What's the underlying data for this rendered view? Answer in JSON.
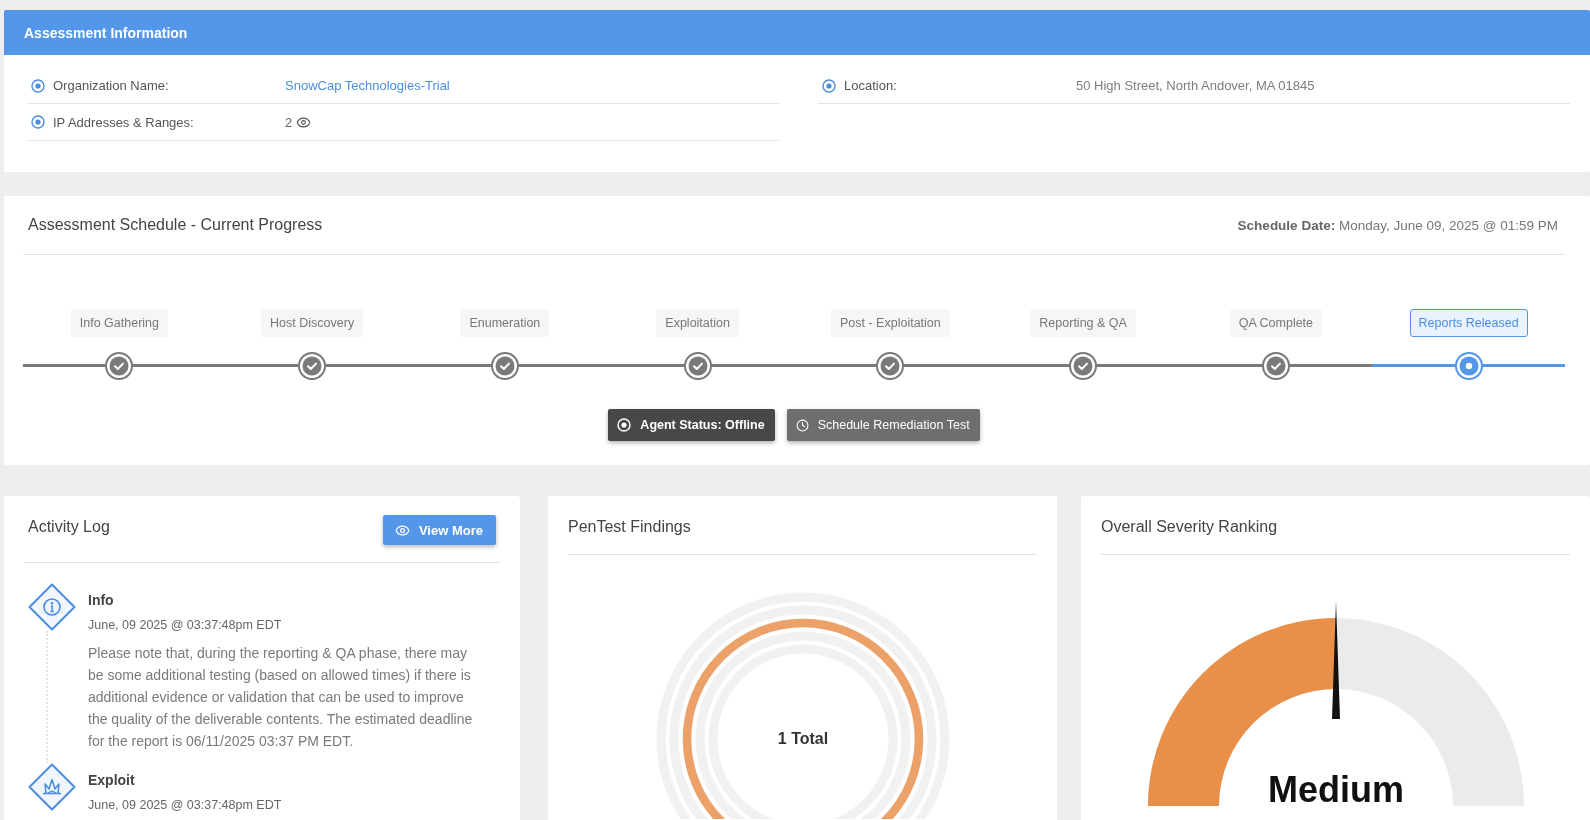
{
  "assessment_info": {
    "title": "Assessment Information",
    "left_fields": [
      {
        "label": "Organization Name:",
        "value": "SnowCap Technologies-Trial",
        "kind": "link"
      },
      {
        "label": "IP Addresses & Ranges:",
        "value": "2",
        "kind": "count"
      }
    ],
    "right_fields": [
      {
        "label": "Location:",
        "value": "50 High Street, North Andover, MA 01845",
        "kind": "text"
      }
    ]
  },
  "schedule": {
    "title": "Assessment Schedule - Current Progress",
    "date_label": "Schedule Date:",
    "date": "Monday, June 09, 2025 @ 01:59 PM",
    "steps": [
      {
        "label": "Info Gathering",
        "completed": true,
        "selected": false
      },
      {
        "label": "Host Discovery",
        "completed": true,
        "selected": false
      },
      {
        "label": "Enumeration",
        "completed": true,
        "selected": false
      },
      {
        "label": "Exploitation",
        "completed": true,
        "selected": false
      },
      {
        "label": "Post - Exploitation",
        "completed": true,
        "selected": false
      },
      {
        "label": "Reporting & QA",
        "completed": true,
        "selected": false
      },
      {
        "label": "QA Complete",
        "completed": true,
        "selected": false
      },
      {
        "label": "Reports Released",
        "completed": false,
        "selected": true
      }
    ],
    "buttons": [
      {
        "label": "Agent Status: Offline",
        "kind": "agent"
      },
      {
        "label": "Schedule Remediation Test",
        "kind": "schedule"
      }
    ]
  },
  "activity_log": {
    "title": "Activity Log",
    "button": "View More",
    "entries": [
      {
        "kind": "info",
        "title": "Info",
        "time": "June, 09 2025 @ 03:37:48pm EDT",
        "text": "Please note that, during the reporting & QA phase, there may be some additional testing (based on allowed times) if there is additional evidence or validation that can be used to improve the quality of the deliverable contents. The estimated deadline for the report is 06/11/2025 03:37 PM EDT."
      },
      {
        "kind": "exploit",
        "title": "Exploit",
        "time": "June, 09 2025 @ 03:37:48pm EDT"
      }
    ]
  },
  "findings": {
    "title": "PenTest Findings",
    "total": "1 Total"
  },
  "severity": {
    "title": "Overall Severity Ranking",
    "level": 0.5,
    "rating": "Medium"
  }
}
